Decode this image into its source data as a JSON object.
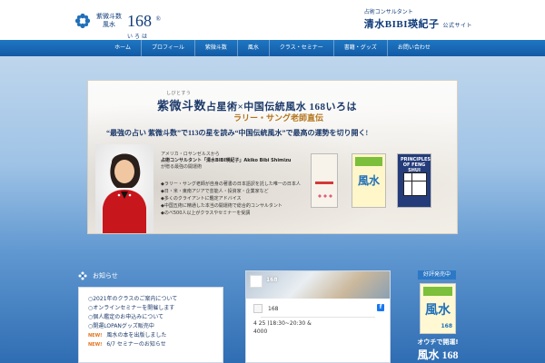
{
  "header": {
    "logo_small_top": "紫微斗数",
    "logo_small_bottom": "風水",
    "logo_number": "168",
    "logo_reg": "®",
    "logo_iroha": "いろは",
    "consultant_line": "占術コンサルタント",
    "name_line": "清水BIBI瑛紀子",
    "official": "公式サイト"
  },
  "nav": {
    "items": [
      "ホーム",
      "プロフィール",
      "紫微斗数",
      "風水",
      "クラス・セミナー",
      "書籍・グッズ",
      "お問い合わせ"
    ]
  },
  "hero": {
    "title_kanji": "紫微斗数",
    "title_rest": "占星術×中国伝統風水 168いろは",
    "title_yomi": "しびとすう",
    "subtitle": "ラリー・サング老師直伝",
    "tagline": "“最強の占い 紫微斗数”で113の星を読み“中国伝統風水”で最高の運勢を切り開く!",
    "intro_line1": "アメリカ・ロサンゼルスから",
    "intro_line2": "占術コンサルタント「清水BIBI瑛紀子」Akiko Bibi Shimizu",
    "intro_line3": "が贈る最強の開運術",
    "bullets": [
      "◆ラリー・サング老師が自身の著書の日本語訳を託した唯一の日本人",
      "◆日・米・東南アジアで芸能人・投資家・企業家など",
      "◆多くのクライアントに鑑定アドバイス",
      "◆中国五術に精通した本当の開運術で総合的コンサルタント",
      "◆のべ500人以上がクラスやセミナーを受講"
    ],
    "book2_title": "風水",
    "book3_title": "PRINCIPLES OF FENG SHUI"
  },
  "news": {
    "title": "お知らせ",
    "items": [
      {
        "text": "○2021年のクラスのご案内について"
      },
      {
        "text": "○オンラインセミナーを開催します"
      },
      {
        "text": "○個人鑑定のお申込みについて"
      },
      {
        "text": "○開運LOPANグッズ販売中"
      },
      {
        "new": "NEW!",
        "text": "風水の本を出版しました"
      },
      {
        "new": "NEW!",
        "text": "6/7 セミナーのお知らせ"
      }
    ]
  },
  "facebook": {
    "page_name": "168",
    "post_name": "168",
    "post_line1": "4 25 )18:30~20:30 &",
    "post_line2": "4000",
    "fb_icon": "f"
  },
  "promo": {
    "title": "好評発売中",
    "book_big": "風水",
    "book_num": "168",
    "caption": "オウチで開運!",
    "big": "風水 168"
  }
}
